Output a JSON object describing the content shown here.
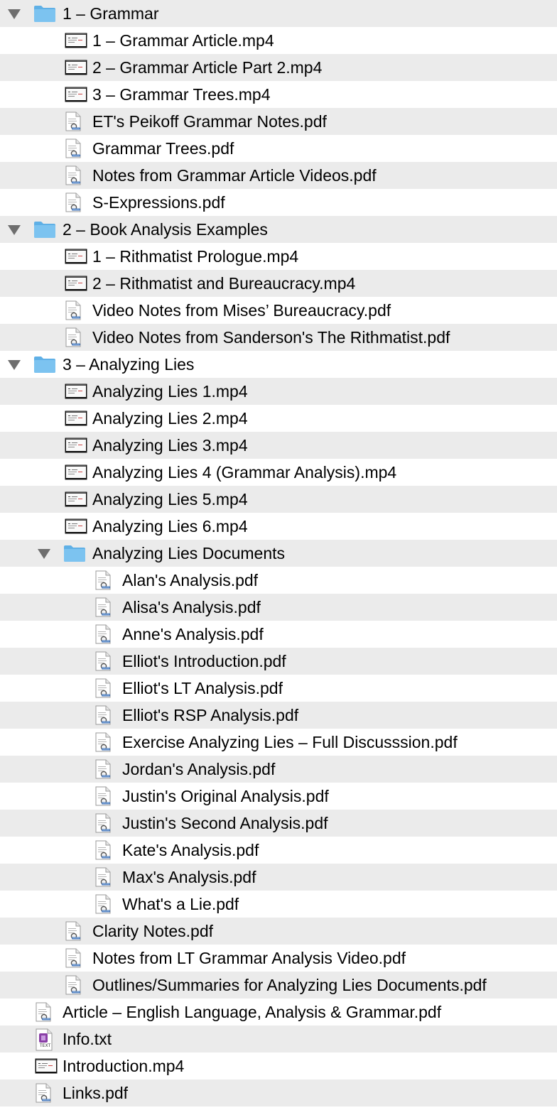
{
  "tree": [
    {
      "label": "1 – Grammar",
      "kind": "folder",
      "level": 0
    },
    {
      "label": "1 – Grammar Article.mp4",
      "kind": "mp4",
      "level": 1
    },
    {
      "label": "2 – Grammar Article Part 2.mp4",
      "kind": "mp4",
      "level": 1
    },
    {
      "label": "3 – Grammar Trees.mp4",
      "kind": "mp4",
      "level": 1
    },
    {
      "label": "ET's Peikoff Grammar Notes.pdf",
      "kind": "pdf",
      "level": 1
    },
    {
      "label": "Grammar Trees.pdf",
      "kind": "pdf",
      "level": 1
    },
    {
      "label": "Notes from Grammar Article Videos.pdf",
      "kind": "pdf",
      "level": 1
    },
    {
      "label": "S-Expressions.pdf",
      "kind": "pdf",
      "level": 1
    },
    {
      "label": "2 – Book Analysis Examples",
      "kind": "folder",
      "level": 0
    },
    {
      "label": "1 – Rithmatist Prologue.mp4",
      "kind": "mp4",
      "level": 1
    },
    {
      "label": "2 – Rithmatist and Bureaucracy.mp4",
      "kind": "mp4",
      "level": 1
    },
    {
      "label": "Video Notes from Mises’ Bureaucracy.pdf",
      "kind": "pdf",
      "level": 1
    },
    {
      "label": "Video Notes from Sanderson's The Rithmatist.pdf",
      "kind": "pdf",
      "level": 1
    },
    {
      "label": "3 – Analyzing Lies",
      "kind": "folder",
      "level": 0
    },
    {
      "label": "Analyzing Lies 1.mp4",
      "kind": "mp4",
      "level": 1
    },
    {
      "label": "Analyzing Lies 2.mp4",
      "kind": "mp4",
      "level": 1
    },
    {
      "label": "Analyzing Lies 3.mp4",
      "kind": "mp4",
      "level": 1
    },
    {
      "label": "Analyzing Lies 4 (Grammar Analysis).mp4",
      "kind": "mp4",
      "level": 1
    },
    {
      "label": "Analyzing Lies 5.mp4",
      "kind": "mp4",
      "level": 1
    },
    {
      "label": "Analyzing Lies 6.mp4",
      "kind": "mp4",
      "level": 1
    },
    {
      "label": "Analyzing Lies Documents",
      "kind": "folder",
      "level": 1
    },
    {
      "label": "Alan's Analysis.pdf",
      "kind": "pdf",
      "level": 2
    },
    {
      "label": "Alisa's Analysis.pdf",
      "kind": "pdf",
      "level": 2
    },
    {
      "label": "Anne's Analysis.pdf",
      "kind": "pdf",
      "level": 2
    },
    {
      "label": "Elliot's Introduction.pdf",
      "kind": "pdf",
      "level": 2
    },
    {
      "label": "Elliot's LT Analysis.pdf",
      "kind": "pdf",
      "level": 2
    },
    {
      "label": "Elliot's RSP Analysis.pdf",
      "kind": "pdf",
      "level": 2
    },
    {
      "label": "Exercise Analyzing Lies – Full Discusssion.pdf",
      "kind": "pdf",
      "level": 2
    },
    {
      "label": "Jordan's Analysis.pdf",
      "kind": "pdf",
      "level": 2
    },
    {
      "label": "Justin's Original Analysis.pdf",
      "kind": "pdf",
      "level": 2
    },
    {
      "label": "Justin's Second Analysis.pdf",
      "kind": "pdf",
      "level": 2
    },
    {
      "label": "Kate's Analysis.pdf",
      "kind": "pdf",
      "level": 2
    },
    {
      "label": "Max's Analysis.pdf",
      "kind": "pdf",
      "level": 2
    },
    {
      "label": "What's a Lie.pdf",
      "kind": "pdf",
      "level": 2
    },
    {
      "label": "Clarity Notes.pdf",
      "kind": "pdf",
      "level": 1
    },
    {
      "label": "Notes from LT Grammar Analysis Video.pdf",
      "kind": "pdf",
      "level": 1
    },
    {
      "label": "Outlines/Summaries for Analyzing Lies Documents.pdf",
      "kind": "pdf",
      "level": 1
    },
    {
      "label": "Article – English Language, Analysis & Grammar.pdf",
      "kind": "pdf",
      "level": 0
    },
    {
      "label": "Info.txt",
      "kind": "txt",
      "level": 0,
      "icon_text": "TEXT"
    },
    {
      "label": "Introduction.mp4",
      "kind": "mp4",
      "level": 0
    },
    {
      "label": "Links.pdf",
      "kind": "pdf",
      "level": 0
    }
  ],
  "colors": {
    "stripe": "#ebebeb",
    "folder": "#7cc3f0",
    "folder_tab": "#5fb0e6",
    "disclosure": "#6e6e6e"
  },
  "icons": {
    "folder": "folder-icon",
    "mp4": "video-file-icon",
    "pdf": "pdf-file-icon",
    "txt": "text-file-icon",
    "disclosure": "disclosure-triangle-expanded-icon"
  }
}
